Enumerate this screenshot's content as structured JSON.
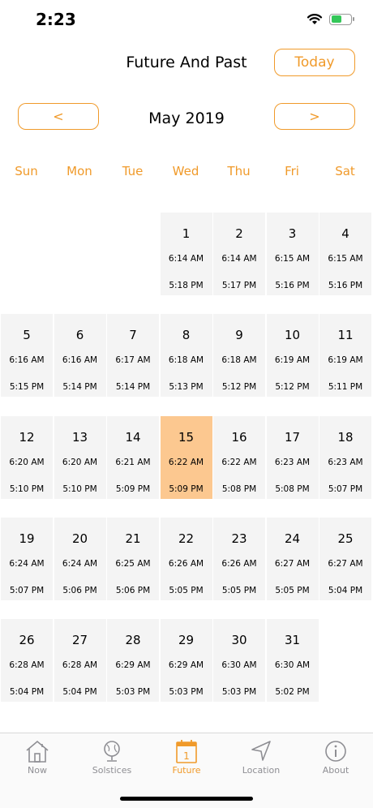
{
  "status": {
    "time": "2:23"
  },
  "header": {
    "title": "Future And Past",
    "today_label": "Today"
  },
  "nav": {
    "prev_label": "<",
    "next_label": ">",
    "month": "May 2019"
  },
  "weekdays": [
    "Sun",
    "Mon",
    "Tue",
    "Wed",
    "Thu",
    "Fri",
    "Sat"
  ],
  "calendar": {
    "first_weekday": 3,
    "selected_day": "15",
    "days": [
      {
        "day": "1",
        "sunrise": "6:14 AM",
        "sunset": "5:18 PM"
      },
      {
        "day": "2",
        "sunrise": "6:14 AM",
        "sunset": "5:17 PM"
      },
      {
        "day": "3",
        "sunrise": "6:15 AM",
        "sunset": "5:16 PM"
      },
      {
        "day": "4",
        "sunrise": "6:15 AM",
        "sunset": "5:16 PM"
      },
      {
        "day": "5",
        "sunrise": "6:16 AM",
        "sunset": "5:15 PM"
      },
      {
        "day": "6",
        "sunrise": "6:16 AM",
        "sunset": "5:14 PM"
      },
      {
        "day": "7",
        "sunrise": "6:17 AM",
        "sunset": "5:14 PM"
      },
      {
        "day": "8",
        "sunrise": "6:18 AM",
        "sunset": "5:13 PM"
      },
      {
        "day": "9",
        "sunrise": "6:18 AM",
        "sunset": "5:12 PM"
      },
      {
        "day": "10",
        "sunrise": "6:19 AM",
        "sunset": "5:12 PM"
      },
      {
        "day": "11",
        "sunrise": "6:19 AM",
        "sunset": "5:11 PM"
      },
      {
        "day": "12",
        "sunrise": "6:20 AM",
        "sunset": "5:10 PM"
      },
      {
        "day": "13",
        "sunrise": "6:20 AM",
        "sunset": "5:10 PM"
      },
      {
        "day": "14",
        "sunrise": "6:21 AM",
        "sunset": "5:09 PM"
      },
      {
        "day": "15",
        "sunrise": "6:22 AM",
        "sunset": "5:09 PM"
      },
      {
        "day": "16",
        "sunrise": "6:22 AM",
        "sunset": "5:08 PM"
      },
      {
        "day": "17",
        "sunrise": "6:23 AM",
        "sunset": "5:08 PM"
      },
      {
        "day": "18",
        "sunrise": "6:23 AM",
        "sunset": "5:07 PM"
      },
      {
        "day": "19",
        "sunrise": "6:24 AM",
        "sunset": "5:07 PM"
      },
      {
        "day": "20",
        "sunrise": "6:24 AM",
        "sunset": "5:06 PM"
      },
      {
        "day": "21",
        "sunrise": "6:25 AM",
        "sunset": "5:06 PM"
      },
      {
        "day": "22",
        "sunrise": "6:26 AM",
        "sunset": "5:05 PM"
      },
      {
        "day": "23",
        "sunrise": "6:26 AM",
        "sunset": "5:05 PM"
      },
      {
        "day": "24",
        "sunrise": "6:27 AM",
        "sunset": "5:05 PM"
      },
      {
        "day": "25",
        "sunrise": "6:27 AM",
        "sunset": "5:04 PM"
      },
      {
        "day": "26",
        "sunrise": "6:28 AM",
        "sunset": "5:04 PM"
      },
      {
        "day": "27",
        "sunrise": "6:28 AM",
        "sunset": "5:04 PM"
      },
      {
        "day": "28",
        "sunrise": "6:29 AM",
        "sunset": "5:03 PM"
      },
      {
        "day": "29",
        "sunrise": "6:29 AM",
        "sunset": "5:03 PM"
      },
      {
        "day": "30",
        "sunrise": "6:30 AM",
        "sunset": "5:03 PM"
      },
      {
        "day": "31",
        "sunrise": "6:30 AM",
        "sunset": "5:02 PM"
      }
    ]
  },
  "tabs": [
    {
      "label": "Now",
      "icon": "house-icon",
      "active": false
    },
    {
      "label": "Solstices",
      "icon": "globe-icon",
      "active": false
    },
    {
      "label": "Future",
      "icon": "calendar-icon",
      "active": true,
      "badge": "1"
    },
    {
      "label": "Location",
      "icon": "location-arrow-icon",
      "active": false
    },
    {
      "label": "About",
      "icon": "info-icon",
      "active": false
    }
  ],
  "colors": {
    "accent": "#f09a2a",
    "selected": "#fcc890",
    "cell": "#f4f4f4",
    "inactive": "#8e8e93"
  }
}
